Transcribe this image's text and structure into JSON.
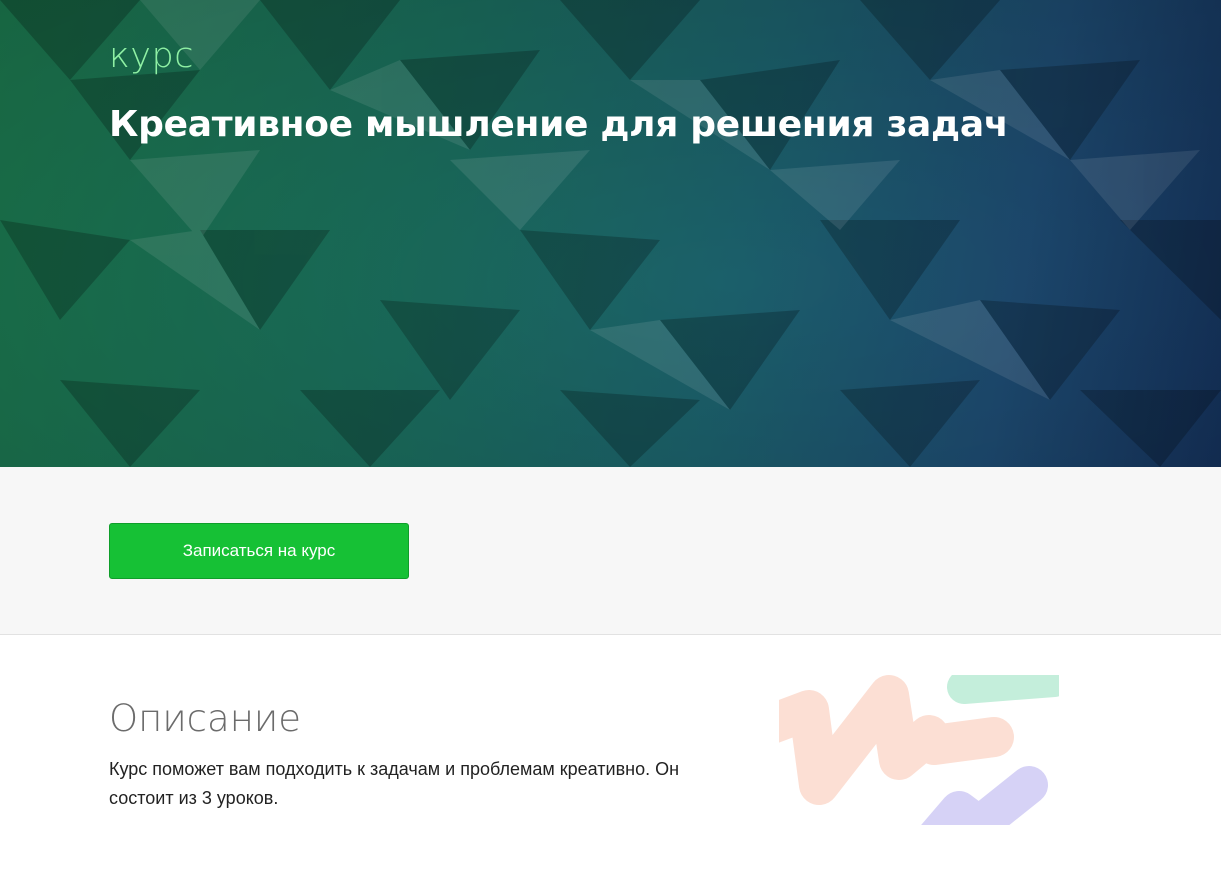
{
  "hero": {
    "label": "курс",
    "title": "Креативное мышление для решения задач"
  },
  "enroll": {
    "button_label": "Записаться на курс",
    "button_color": "#16c135"
  },
  "description": {
    "heading": "Описание",
    "text": "Курс поможет вам подходить к задачам и проблемам креативно. Он состоит из 3 уроков."
  },
  "colors": {
    "hero_label": "#8ff0a4",
    "hero_gradient_start": "#1c7b50",
    "hero_gradient_end": "#14315a",
    "illustration_peach": "#fcdfd4",
    "illustration_mint": "#c4eedb",
    "illustration_lavender": "#d6d2f6"
  }
}
